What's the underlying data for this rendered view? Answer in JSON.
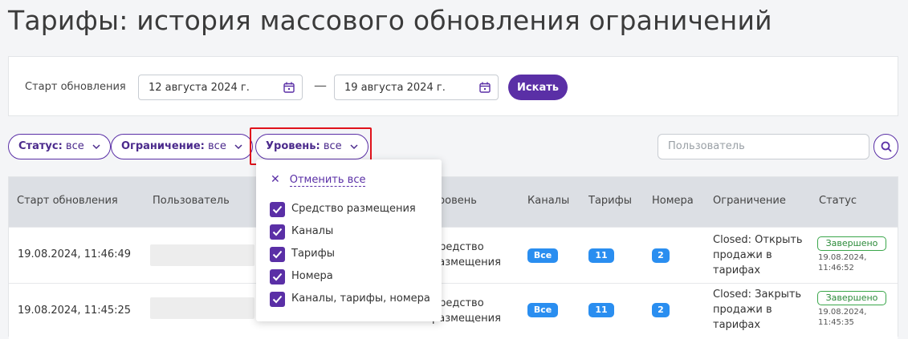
{
  "page": {
    "title": "Тарифы: история массового обновления ограничений"
  },
  "search": {
    "label": "Старт обновления",
    "date_from": "12 августа 2024 г.",
    "date_to": "19 августа 2024 г.",
    "dash": "—",
    "button_label": "Искать"
  },
  "filters": {
    "status": {
      "key": "Статус:",
      "value": "все"
    },
    "restriction": {
      "key": "Ограничение:",
      "value": "все"
    },
    "level": {
      "key": "Уровень:",
      "value": "все"
    },
    "user_placeholder": "Пользователь"
  },
  "dropdown": {
    "clear_label": "Отменить все",
    "options": [
      {
        "label": "Средство размещения",
        "checked": true
      },
      {
        "label": "Каналы",
        "checked": true
      },
      {
        "label": "Тарифы",
        "checked": true
      },
      {
        "label": "Номера",
        "checked": true
      },
      {
        "label": "Каналы, тарифы, номера",
        "checked": true
      }
    ]
  },
  "table": {
    "headers": [
      "Старт обновления",
      "Пользователь",
      "Уровень",
      "Каналы",
      "Тарифы",
      "Номера",
      "Ограничение",
      "Статус"
    ],
    "rows": [
      {
        "start": "19.08.2024, 11:46:49",
        "level_line1": "Средство",
        "level_line2": "размещения",
        "channels": "Все",
        "tariffs": "11",
        "rooms": "2",
        "restriction_line1": "Closed: Открыть",
        "restriction_line2": "продажи в",
        "restriction_line3": "тарифах",
        "status": "Завершено",
        "status_date": "19.08.2024,",
        "status_time": "11:46:52"
      },
      {
        "start": "19.08.2024, 11:45:25",
        "level_line1": "Средство",
        "level_line2": "размещения",
        "channels": "Все",
        "tariffs": "11",
        "rooms": "2",
        "restriction_line1": "Closed: Закрыть",
        "restriction_line2": "продажи в",
        "restriction_line3": "тарифах",
        "status": "Завершено",
        "status_date": "19.08.2024,",
        "status_time": "11:45:35"
      }
    ]
  },
  "colors": {
    "accent": "#5a2fa6",
    "badge_blue": "#2a8ef0",
    "status_green": "#3aa64a",
    "highlight_red": "#e0121b"
  },
  "icons": {
    "calendar": "calendar-icon",
    "chevron": "chevron-down-icon",
    "search": "search-icon",
    "check": "check-icon",
    "close": "close-icon"
  }
}
